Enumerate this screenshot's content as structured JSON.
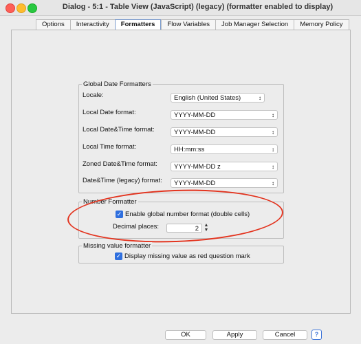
{
  "window": {
    "title": "Dialog - 5:1 - Table View (JavaScript) (legacy) (formatter enabled to display)"
  },
  "tabs": [
    {
      "label": "Options"
    },
    {
      "label": "Interactivity"
    },
    {
      "label": "Formatters"
    },
    {
      "label": "Flow Variables"
    },
    {
      "label": "Job Manager Selection"
    },
    {
      "label": "Memory Policy"
    }
  ],
  "active_tab": "Formatters",
  "date_formatters": {
    "title": "Global Date Formatters",
    "rows": [
      {
        "label": "Locale:",
        "value": "English (United States)"
      },
      {
        "label": "Local Date format:",
        "value": "YYYY-MM-DD"
      },
      {
        "label": "Local Date&Time format:",
        "value": "YYYY-MM-DD"
      },
      {
        "label": "Local Time format:",
        "value": "HH:mm:ss"
      },
      {
        "label": "Zoned Date&Time format:",
        "value": "YYYY-MM-DD z"
      },
      {
        "label": "Date&Time (legacy) format:",
        "value": "YYYY-MM-DD"
      }
    ]
  },
  "number_formatter": {
    "title": "Number Formatter",
    "checkbox_label": "Enable global number format (double cells)",
    "checked": true,
    "decimal_label": "Decimal places:",
    "decimal_value": "2"
  },
  "missing_formatter": {
    "title": "Missing value formatter",
    "checkbox_label": "Display missing value as red question mark",
    "checked": true
  },
  "buttons": {
    "ok": "OK",
    "apply": "Apply",
    "cancel": "Cancel",
    "help": "?"
  },
  "colors": {
    "accent": "#2f6fde",
    "annotation": "#e3341f"
  }
}
